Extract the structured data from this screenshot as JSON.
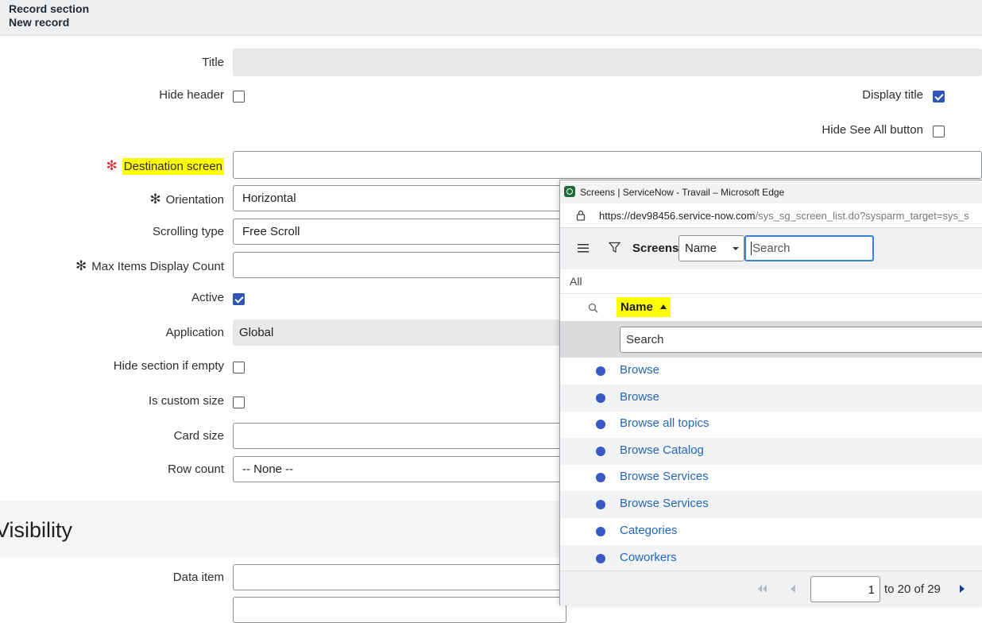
{
  "header": {
    "line1": "Record section",
    "line2": "New record"
  },
  "form": {
    "title_label": "Title",
    "hide_header_label": "Hide header",
    "display_title_label": "Display title",
    "display_title_checked": true,
    "hide_see_all_label": "Hide See All button",
    "destination_label": "Destination screen",
    "orientation_label": "Orientation",
    "orientation_value": "Horizontal",
    "scrolling_label": "Scrolling type",
    "scrolling_value": "Free Scroll",
    "max_items_label": "Max Items Display Count",
    "active_label": "Active",
    "active_checked": true,
    "application_label": "Application",
    "application_value": "Global",
    "hide_empty_label": "Hide section if empty",
    "custom_size_label": "Is custom size",
    "card_size_label": "Card size",
    "row_count_label": "Row count",
    "row_count_value": "-- None --",
    "required_mark": "✻"
  },
  "visibility": {
    "title": "Visibility",
    "data_item_label": "Data item"
  },
  "popup": {
    "window_title": "Screens | ServiceNow - Travail – Microsoft Edge",
    "url_host": "https://dev98456.service-now.com",
    "url_path": "/sys_sg_screen_list.do?sysparm_target=sys_s",
    "list_title": "Screens",
    "field_select": "Name",
    "search_placeholder": "Search",
    "breadcrumb": "All",
    "column_name": "Name",
    "column_search_placeholder": "Search",
    "rows": [
      "Browse",
      "Browse",
      "Browse all topics",
      "Browse Catalog",
      "Browse Services",
      "Browse Services",
      "Categories",
      "Coworkers"
    ],
    "page_value": "1",
    "page_text": "to 20 of 29"
  },
  "colors": {
    "accent": "#2f55b8",
    "link": "#2566b8",
    "highlight": "#ffff00",
    "required": "#d62f2f"
  }
}
